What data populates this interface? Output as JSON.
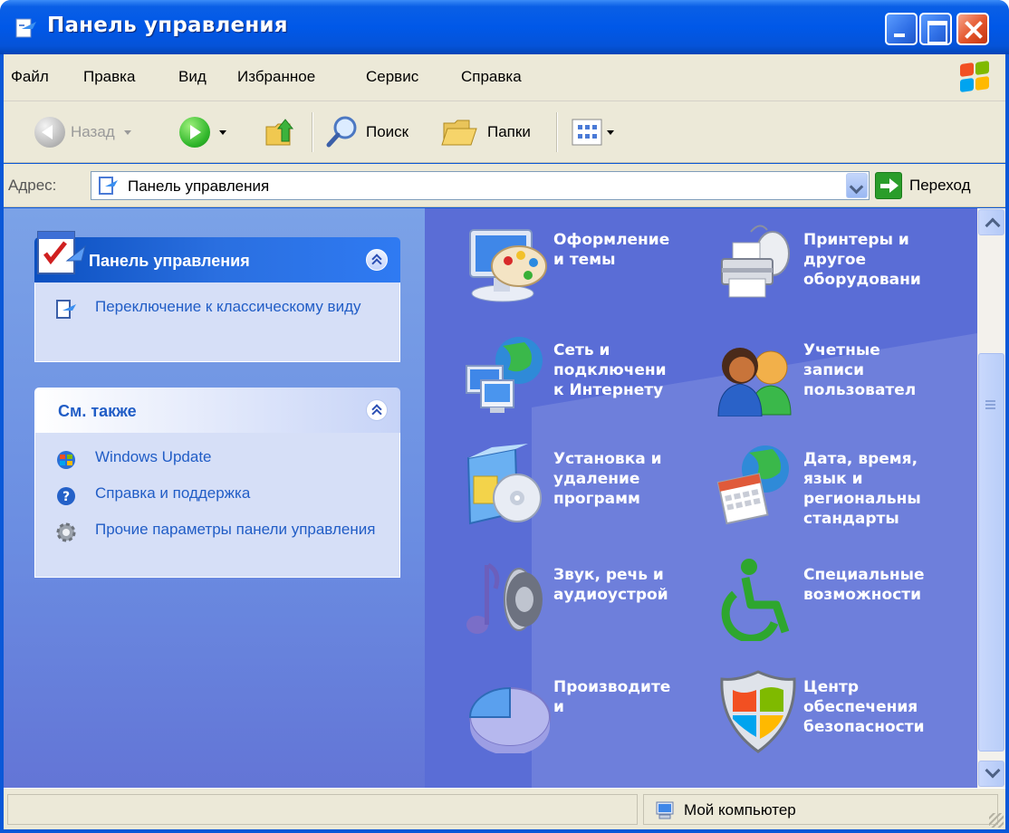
{
  "window": {
    "title": "Панель управления"
  },
  "menu": {
    "items": [
      "Файл",
      "Правка",
      "Вид",
      "Избранное",
      "Сервис",
      "Справка"
    ]
  },
  "toolbar": {
    "back_label": "Назад",
    "search_label": "Поиск",
    "folders_label": "Папки"
  },
  "address": {
    "label": "Адрес:",
    "value": "Панель управления",
    "go_label": "Переход"
  },
  "sidebar": {
    "panel1": {
      "title": "Панель управления",
      "link": "Переключение к классическому виду"
    },
    "panel2": {
      "title": "См. также",
      "links": [
        {
          "label": "Windows Update",
          "icon": "windows-update-icon"
        },
        {
          "label": "Справка и поддержка",
          "icon": "help-icon"
        },
        {
          "label": "Прочие параметры панели управления",
          "icon": "gear-icon"
        }
      ]
    }
  },
  "categories": [
    {
      "label": "Оформление\nи темы",
      "icon": "appearance-themes-icon"
    },
    {
      "label": "Принтеры и\nдругое\nоборудовани",
      "icon": "printer-icon"
    },
    {
      "label": "Сеть и\nподключени\nк Интернету",
      "icon": "network-icon"
    },
    {
      "label": "Учетные\nзаписи\nпользовател",
      "icon": "user-accounts-icon"
    },
    {
      "label": "Установка и\nудаление\nпрограмм",
      "icon": "add-remove-programs-icon"
    },
    {
      "label": "Дата, время,\nязык и\nрегиональны\nстандарты",
      "icon": "date-time-globe-icon"
    },
    {
      "label": "Звук, речь и\nаудиоустрой",
      "icon": "sound-icon"
    },
    {
      "label": "Специальные\nвозможности",
      "icon": "accessibility-icon"
    },
    {
      "label": "Производите\nи",
      "icon": "performance-icon"
    },
    {
      "label": "Центр\nобеспечения\nбезопасности",
      "icon": "security-shield-icon"
    }
  ],
  "status": {
    "location": "Мой компьютер"
  },
  "colors": {
    "title_bar": "#0058e8",
    "content_bg": "#5a6dd6",
    "link": "#215dc6"
  }
}
